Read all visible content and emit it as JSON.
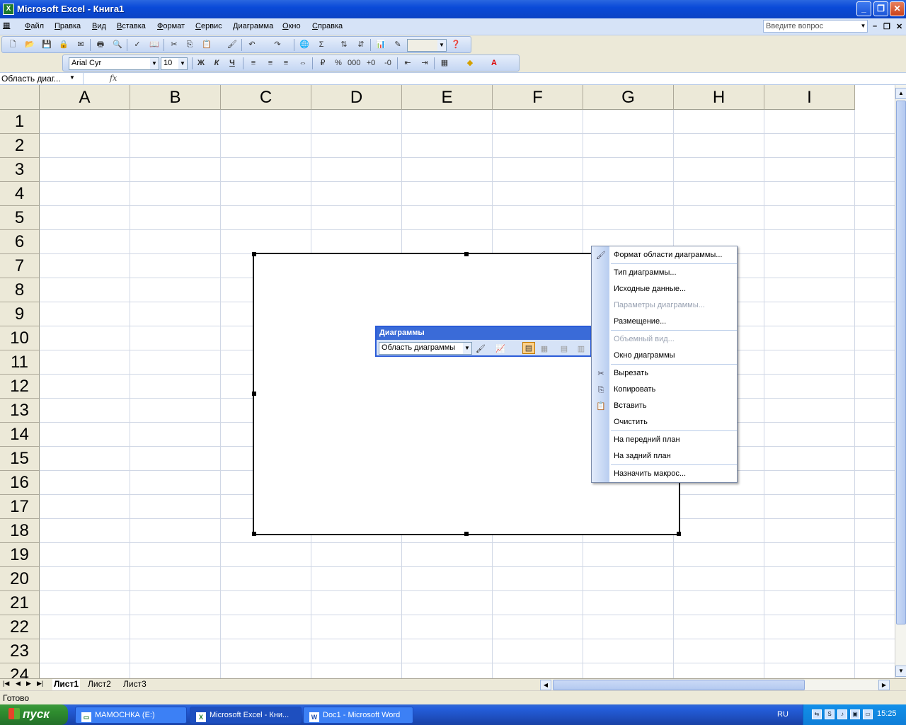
{
  "window": {
    "title": "Microsoft Excel - Книга1"
  },
  "menu": [
    "Файл",
    "Правка",
    "Вид",
    "Вставка",
    "Формат",
    "Сервис",
    "Диаграмма",
    "Окно",
    "Справка"
  ],
  "ask_question": {
    "placeholder": "Введите вопрос"
  },
  "formatting": {
    "font": "Arial Cyr",
    "size": "10",
    "bold": "Ж",
    "italic": "К",
    "underline": "Ч"
  },
  "formula_bar": {
    "name_box": "Область диаг...",
    "fx": "fx"
  },
  "columns": [
    "A",
    "B",
    "C",
    "D",
    "E",
    "F",
    "G",
    "H",
    "I"
  ],
  "rows": [
    "1",
    "2",
    "3",
    "4",
    "5",
    "6",
    "7",
    "8",
    "9",
    "10",
    "11",
    "12",
    "13",
    "14",
    "15",
    "16",
    "17",
    "18",
    "19",
    "20",
    "21",
    "22",
    "23",
    "24"
  ],
  "chart_toolbar": {
    "title": "Диаграммы",
    "object": "Область диаграммы"
  },
  "context_menu": [
    {
      "label": "Формат области диаграммы...",
      "icon": "format-icon",
      "enabled": true
    },
    {
      "label": "Тип диаграммы...",
      "enabled": true
    },
    {
      "label": "Исходные данные...",
      "enabled": true
    },
    {
      "label": "Параметры диаграммы...",
      "enabled": false
    },
    {
      "label": "Размещение...",
      "enabled": true
    },
    {
      "label": "Объемный вид...",
      "enabled": false
    },
    {
      "label": "Окно диаграммы",
      "enabled": true
    },
    {
      "label": "Вырезать",
      "icon": "scissors-icon",
      "enabled": true
    },
    {
      "label": "Копировать",
      "icon": "copy-icon",
      "enabled": true
    },
    {
      "label": "Вставить",
      "icon": "paste-icon",
      "enabled": true
    },
    {
      "label": "Очистить",
      "enabled": true
    },
    {
      "label": "На передний план",
      "enabled": true
    },
    {
      "label": "На задний план",
      "enabled": true
    },
    {
      "label": "Назначить макрос...",
      "enabled": true
    }
  ],
  "sheets": [
    "Лист1",
    "Лист2",
    "Лист3"
  ],
  "status": "Готово",
  "taskbar": {
    "start": "пуск",
    "tasks": [
      "МАМОСНКА (E:)",
      "Microsoft Excel - Кни...",
      "Doc1 - Microsoft Word"
    ],
    "language": "RU",
    "clock": "15:25"
  }
}
